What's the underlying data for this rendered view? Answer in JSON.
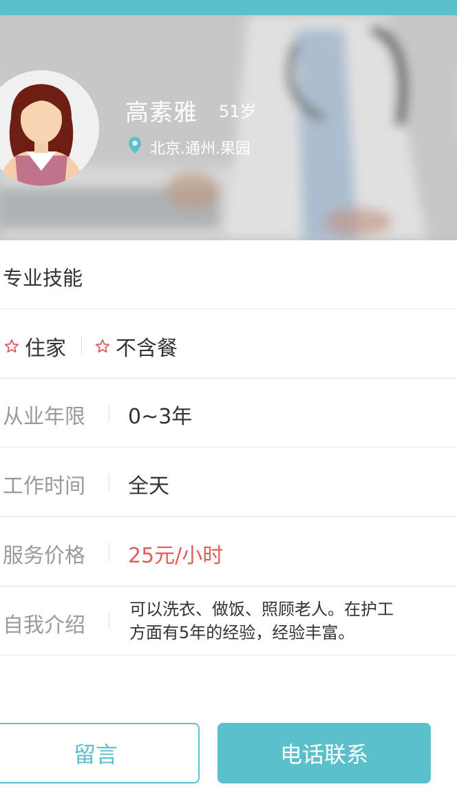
{
  "header": {
    "bar_color": "#5bc0cc"
  },
  "profile": {
    "name": "高素雅",
    "age": "51岁",
    "location": "北京.通州.果园",
    "location_icon": "location-pin-icon",
    "avatar_icon": "female-avatar-icon"
  },
  "skills": {
    "title": "专业技能",
    "tags": [
      {
        "icon": "star-outline-icon",
        "label": "住家"
      },
      {
        "icon": "star-outline-icon",
        "label": "不含餐"
      }
    ]
  },
  "details": [
    {
      "label": "从业年限",
      "value": "0~3年"
    },
    {
      "label": "工作时间",
      "value": "全天"
    },
    {
      "label": "服务价格",
      "value": "25元/小时"
    },
    {
      "label": "自我介绍",
      "value": "可以洗衣、做饭、照顾老人。在护工方面有5年的经验，经验丰富。"
    }
  ],
  "actions": {
    "message": "留言",
    "call": "电话联系"
  },
  "colors": {
    "accent": "#5bc0cc",
    "price": "#e25b5b",
    "label": "#9a9a9a",
    "text": "#333333"
  }
}
